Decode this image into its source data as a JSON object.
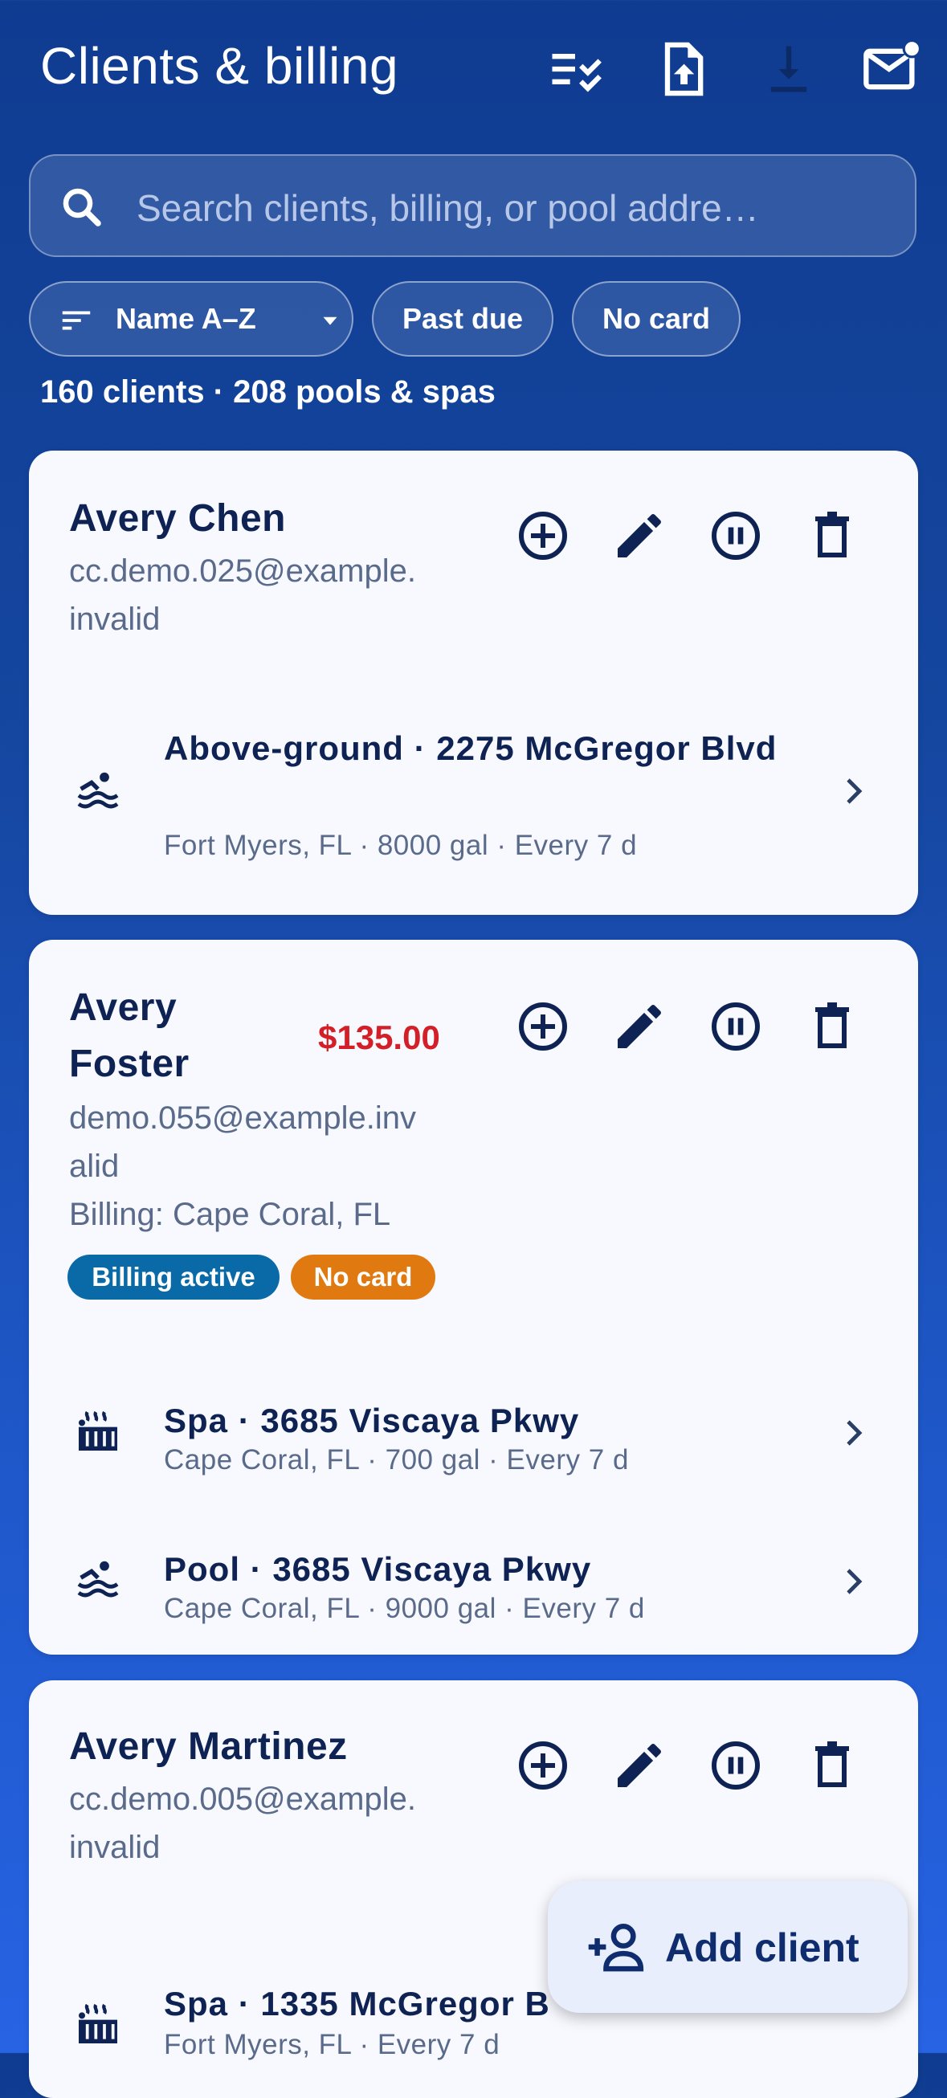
{
  "header": {
    "title": "Clients & billing",
    "icons": [
      "checklist-icon",
      "file-upload-icon",
      "download-icon",
      "mail-notification-icon"
    ]
  },
  "search": {
    "placeholder": "Search clients, billing, or pool addre…"
  },
  "filters": {
    "sort_label": "Name A–Z",
    "past_due_label": "Past due",
    "no_card_label": "No card"
  },
  "summary": "160 clients · 208 pools & spas",
  "clients": [
    {
      "name": "Avery Chen",
      "email_line1": "cc.demo.025@example.",
      "email_line2": "invalid",
      "pools": [
        {
          "icon": "pool-icon",
          "title": "Above-ground · 2275 McGregor Blvd",
          "subtitle": "Fort Myers, FL · 8000 gal · Every 7 d"
        }
      ]
    },
    {
      "name_line1": "Avery",
      "name_line2": "Foster",
      "amount": "$135.00",
      "email_line1": "demo.055@example.inv",
      "email_line2": "alid",
      "billing": "Billing: Cape Coral, FL",
      "badges": [
        {
          "label": "Billing active",
          "color": "#0a6aa8"
        },
        {
          "label": "No card",
          "color": "#e07a10"
        }
      ],
      "pools": [
        {
          "icon": "hot-tub-icon",
          "title": "Spa · 3685 Viscaya Pkwy",
          "subtitle": "Cape Coral, FL · 700 gal · Every 7 d"
        },
        {
          "icon": "pool-icon",
          "title": "Pool · 3685 Viscaya Pkwy",
          "subtitle": "Cape Coral, FL · 9000 gal · Every 7 d"
        }
      ]
    },
    {
      "name": "Avery Martinez",
      "email_line1": "cc.demo.005@example.",
      "email_line2": "invalid",
      "pools": [
        {
          "icon": "hot-tub-icon",
          "title": "Spa · 1335 McGregor B",
          "subtitle": "Fort Myers, FL · Every 7 d"
        }
      ]
    }
  ],
  "card_actions": [
    "add-circle-icon",
    "edit-icon",
    "pause-circle-icon",
    "delete-icon"
  ],
  "fab": {
    "label": "Add client",
    "icon": "person-add-icon"
  },
  "colors": {
    "background_top": "#0f3c91",
    "background_bottom": "#2763e3",
    "card": "#f7f9ff",
    "text_dark": "#0e2353",
    "text_muted": "#5a6a8a",
    "amount_red": "#d32028"
  }
}
